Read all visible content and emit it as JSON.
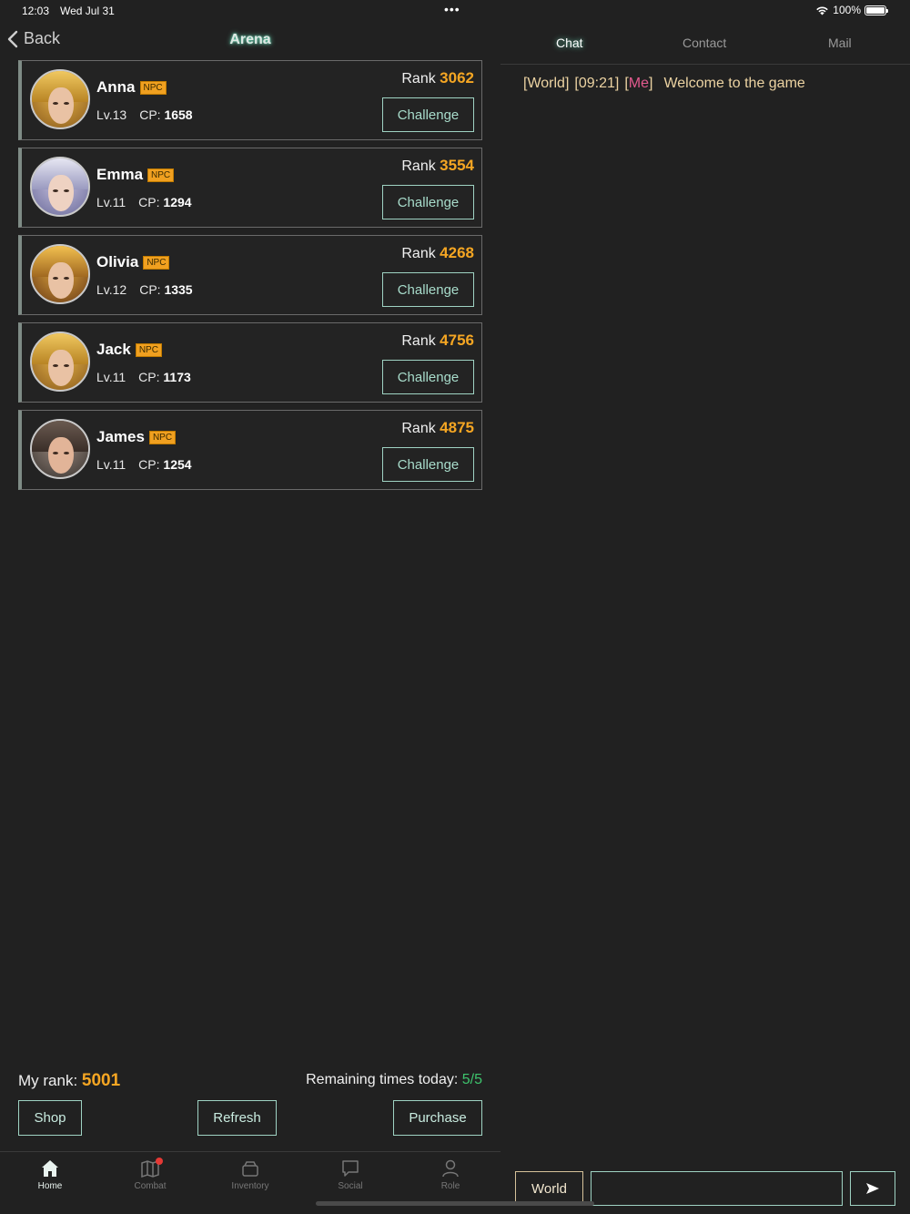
{
  "status_bar": {
    "time": "12:03",
    "date": "Wed Jul 31",
    "battery": "100%"
  },
  "header": {
    "back_label": "Back",
    "title": "Arena"
  },
  "opponents": [
    {
      "name": "Anna",
      "badge": "NPC",
      "level": "Lv.13",
      "cp_label": "CP:",
      "cp": "1658",
      "rank_label": "Rank",
      "rank": "3062",
      "action": "Challenge"
    },
    {
      "name": "Emma",
      "badge": "NPC",
      "level": "Lv.11",
      "cp_label": "CP:",
      "cp": "1294",
      "rank_label": "Rank",
      "rank": "3554",
      "action": "Challenge"
    },
    {
      "name": "Olivia",
      "badge": "NPC",
      "level": "Lv.12",
      "cp_label": "CP:",
      "cp": "1335",
      "rank_label": "Rank",
      "rank": "4268",
      "action": "Challenge"
    },
    {
      "name": "Jack",
      "badge": "NPC",
      "level": "Lv.11",
      "cp_label": "CP:",
      "cp": "1173",
      "rank_label": "Rank",
      "rank": "4756",
      "action": "Challenge"
    },
    {
      "name": "James",
      "badge": "NPC",
      "level": "Lv.11",
      "cp_label": "CP:",
      "cp": "1254",
      "rank_label": "Rank",
      "rank": "4875",
      "action": "Challenge"
    }
  ],
  "footer": {
    "my_rank_label": "My rank:",
    "my_rank": "5001",
    "remaining_label": "Remaining times today:",
    "remaining": "5/5",
    "shop_label": "Shop",
    "refresh_label": "Refresh",
    "purchase_label": "Purchase"
  },
  "tab_bar": {
    "items": [
      {
        "label": "Home",
        "icon": "home-icon"
      },
      {
        "label": "Combat",
        "icon": "map-icon"
      },
      {
        "label": "Inventory",
        "icon": "box-icon"
      },
      {
        "label": "Social",
        "icon": "chat-bubble-icon"
      },
      {
        "label": "Role",
        "icon": "person-icon"
      }
    ]
  },
  "chat": {
    "tabs": [
      "Chat",
      "Contact",
      "Mail"
    ],
    "messages": [
      {
        "channel": "[World]",
        "time": "[09:21]",
        "sender_open": "[",
        "sender": "Me",
        "sender_close": "]",
        "text": "Welcome to the game"
      }
    ],
    "channel_label": "World",
    "input_value": ""
  },
  "colors": {
    "accent": "#9fd3c3",
    "rank": "#f5a623",
    "remaining": "#3ec46d",
    "me": "#e35a8f",
    "chat_text": "#ecd3a2"
  }
}
